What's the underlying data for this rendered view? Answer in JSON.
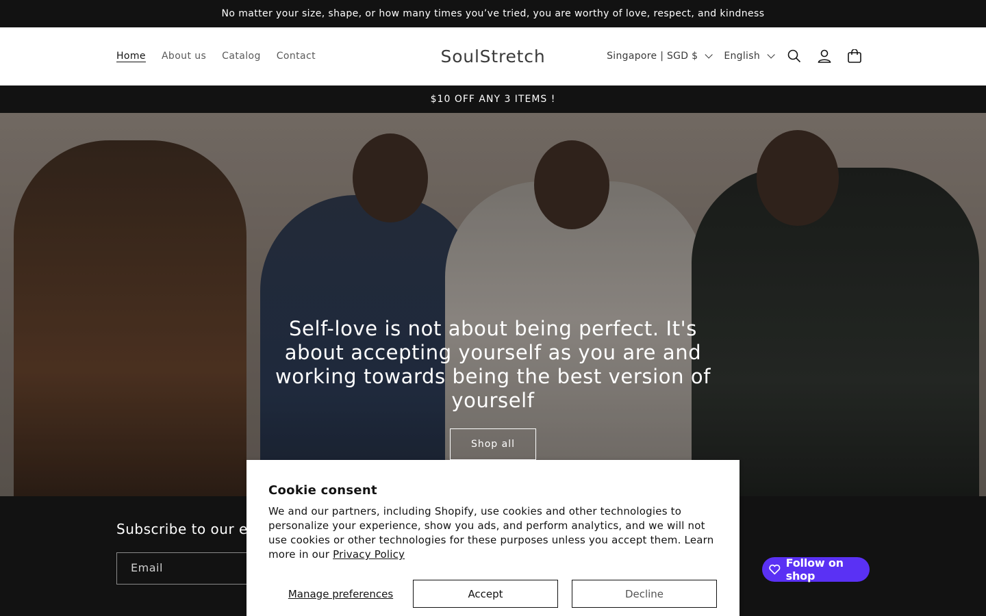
{
  "announcement": {
    "text": "No matter your size, shape, or how many times you’ve tried, you are worthy of love, respect, and kindness"
  },
  "header": {
    "nav": [
      "Home",
      "About us",
      "Catalog",
      "Contact"
    ],
    "logo": "SoulStretch",
    "country_selector": "Singapore | SGD $",
    "language_selector": "English",
    "icons": [
      "search-icon",
      "account-icon",
      "cart-icon"
    ]
  },
  "promo": {
    "text": "$10 OFF ANY 3 ITEMS !"
  },
  "hero": {
    "title": "Self-love is not about being perfect. It's about accepting yourself as you are and working towards being the best version of yourself",
    "button": "Shop all"
  },
  "footer": {
    "subscribe_title": "Subscribe to our emails",
    "email_placeholder": "Email",
    "follow_shop": "Follow on shop"
  },
  "cookie": {
    "title": "Cookie consent",
    "text": "We and our partners, including Shopify, use cookies and other technologies to personalize your experience, show you ads, and perform analytics, and we will not use cookies or other technologies for these purposes unless you accept them. Learn more in our",
    "link": "Privacy Policy",
    "manage": "Manage preferences",
    "accept": "Accept",
    "decline": "Decline"
  },
  "colors": {
    "dark": "#121212",
    "shop_purple": "#5a31f4"
  }
}
